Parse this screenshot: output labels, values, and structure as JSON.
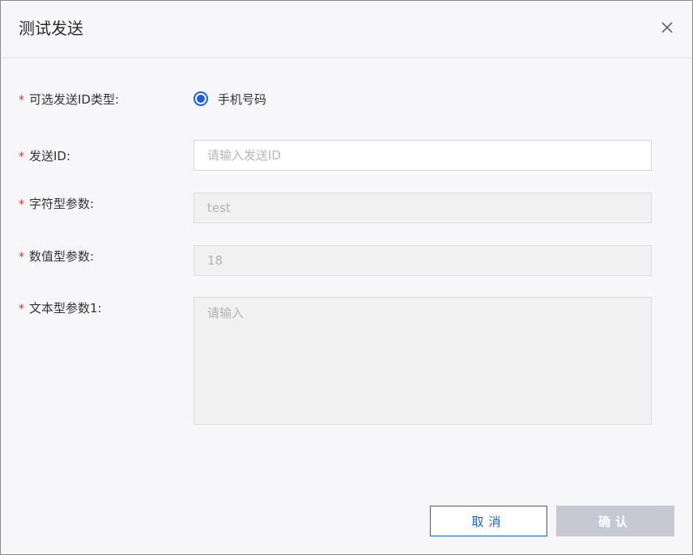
{
  "dialog": {
    "title": "测试发送"
  },
  "form": {
    "id_type": {
      "required_mark": "*",
      "label": "可选发送ID类型:",
      "option_label": "手机号码",
      "selected": true
    },
    "send_id": {
      "required_mark": "*",
      "label": "发送ID:",
      "placeholder": "请输入发送ID",
      "value": ""
    },
    "string_param": {
      "required_mark": "*",
      "label": "字符型参数:",
      "value": "test"
    },
    "numeric_param": {
      "required_mark": "*",
      "label": "数值型参数:",
      "value": "18"
    },
    "text_param": {
      "required_mark": "*",
      "label": "文本型参数1:",
      "placeholder": "请输入"
    }
  },
  "footer": {
    "cancel_label": "取消",
    "confirm_label": "确认"
  },
  "colors": {
    "primary": "#1a5fe0",
    "required": "#d93026",
    "disabled_button": "#c6c9d3"
  }
}
